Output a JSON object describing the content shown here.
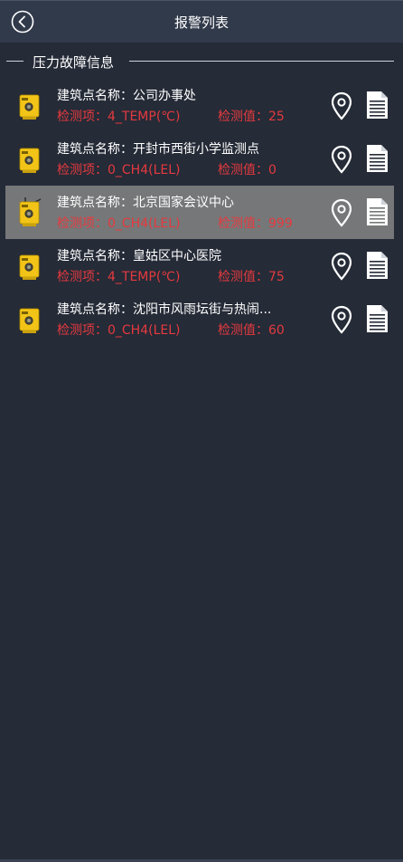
{
  "header": {
    "title": "报警列表",
    "back_icon": "chevron-left-circle-icon"
  },
  "section": {
    "title": "压力故障信息"
  },
  "colors": {
    "background": "#252b37",
    "header": "#313a4a",
    "alert_text": "#e53a3f",
    "selected_row": "#767778",
    "device_icon": "#f2c418"
  },
  "alarms": [
    {
      "name": "建筑点名称：公司办事处",
      "item": "检测项：4_TEMP(℃)",
      "value": "检测值：25",
      "selected": false
    },
    {
      "name": "建筑点名称：开封市西街小学监测点",
      "item": "检测项：0_CH4(LEL)",
      "value": "检测值：0",
      "selected": false
    },
    {
      "name": "建筑点名称：北京国家会议中心",
      "item": "检测项：0_CH4(LEL)",
      "value": "检测值：999",
      "selected": true
    },
    {
      "name": "建筑点名称：皇姑区中心医院",
      "item": "检测项：4_TEMP(℃)",
      "value": "检测值：75",
      "selected": false
    },
    {
      "name": "建筑点名称：沈阳市风雨坛街与热闹...",
      "item": "检测项：0_CH4(LEL)",
      "value": "检测值：60",
      "selected": false
    }
  ]
}
